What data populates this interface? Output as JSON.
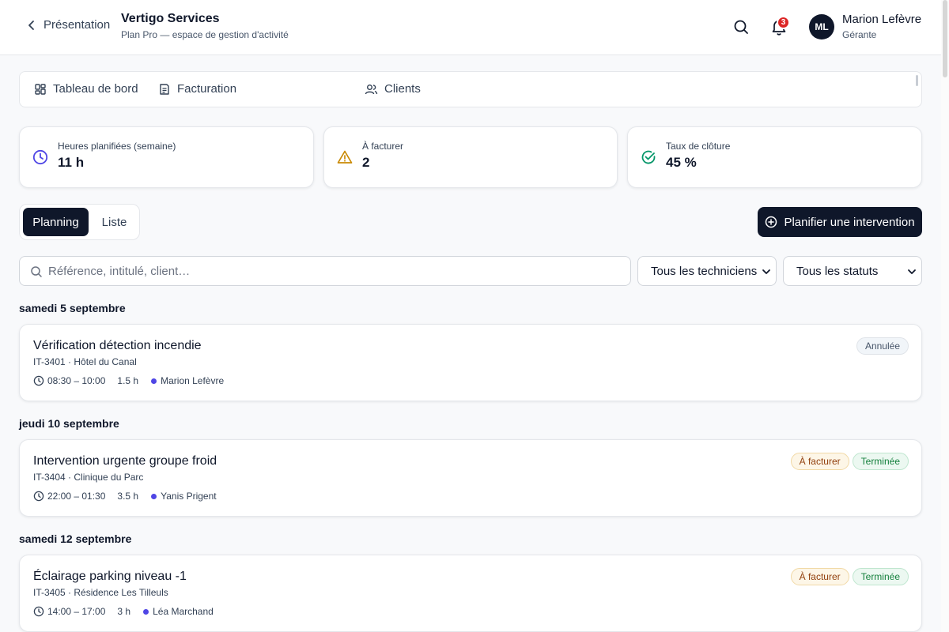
{
  "header": {
    "back_label": "Présentation",
    "company": "Vertigo Services",
    "plan": "Plan Pro — espace de gestion d'activité",
    "notifications_count": "3",
    "user_initials": "ML",
    "user_name": "Marion Lefèvre",
    "user_role": "Gérante"
  },
  "tabs": [
    {
      "label": "Tableau de bord",
      "icon": "dashboard-icon"
    },
    {
      "label": "Facturation",
      "icon": "invoice-icon"
    },
    {
      "label": "Clients",
      "icon": "users-icon"
    }
  ],
  "stats": [
    {
      "label": "Heures planifiées (semaine)",
      "value": "11 h",
      "icon": "clock-icon",
      "color": "#4f46e5"
    },
    {
      "label": "À facturer",
      "value": "2",
      "icon": "warning-icon",
      "color": "#ca8a04"
    },
    {
      "label": "Taux de clôture",
      "value": "45 %",
      "icon": "check-circle-icon",
      "color": "#059669"
    }
  ],
  "view_toggle": {
    "planning": "Planning",
    "list": "Liste",
    "selected": "Planning"
  },
  "cta_label": "Planifier une intervention",
  "search": {
    "placeholder": "Référence, intitulé, client…",
    "value": ""
  },
  "filters": {
    "technician": "Tous les techniciens",
    "status": "Tous les statuts"
  },
  "groups": [
    {
      "date": "samedi 5 septembre",
      "items": [
        {
          "title": "Vérification détection incendie",
          "ref": "IT-3401 · Hôtel du Canal",
          "time": "08:30 – 10:00",
          "duration": "1.5 h",
          "technician": "Marion Lefèvre",
          "badges": [
            "Annulée"
          ]
        }
      ]
    },
    {
      "date": "jeudi 10 septembre",
      "items": [
        {
          "title": "Intervention urgente groupe froid",
          "ref": "IT-3404 · Clinique du Parc",
          "time": "22:00 – 01:30",
          "duration": "3.5 h",
          "technician": "Yanis Prigent",
          "badges": [
            "À facturer",
            "Terminée"
          ]
        }
      ]
    },
    {
      "date": "samedi 12 septembre",
      "items": [
        {
          "title": "Éclairage parking niveau -1",
          "ref": "IT-3405 · Résidence Les Tilleuls",
          "time": "14:00 – 17:00",
          "duration": "3 h",
          "technician": "Léa Marchand",
          "badges": [
            "À facturer",
            "Terminée"
          ]
        }
      ]
    }
  ],
  "colors": {
    "primary": "#0f172a",
    "accent": "#4f46e5",
    "warning": "#ca8a04",
    "success": "#059669",
    "danger": "#dc2626"
  }
}
